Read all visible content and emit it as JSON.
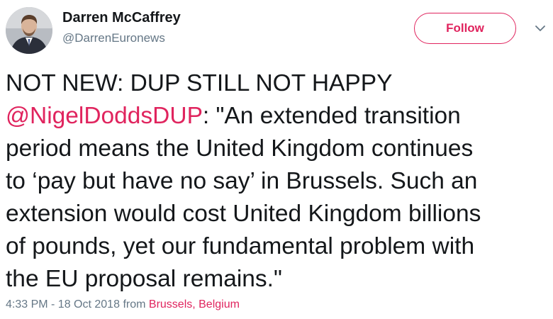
{
  "author": {
    "display_name": "Darren McCaffrey",
    "handle": "@DarrenEuronews"
  },
  "actions": {
    "follow_label": "Follow",
    "menu_icon": "chevron-down-icon"
  },
  "tweet": {
    "line1": "NOT NEW: DUP STILL NOT HAPPY",
    "mention": "@NigelDoddsDUP",
    "line2_rest": ": \"An extended transition",
    "line3": "period means the United Kingdom continues",
    "line4": "to ‘pay but have no say’ in Brussels. Such an",
    "line5": "extension would cost United Kingdom billions",
    "line6": "of pounds, yet our fundamental problem with",
    "line7": "the EU proposal remains.\""
  },
  "meta": {
    "timestamp": "4:33 PM - 18 Oct 2018",
    "from_label": "from",
    "location": "Brussels, Belgium"
  },
  "colors": {
    "accent": "#e0245e",
    "text": "#14171a",
    "secondary": "#657786"
  }
}
